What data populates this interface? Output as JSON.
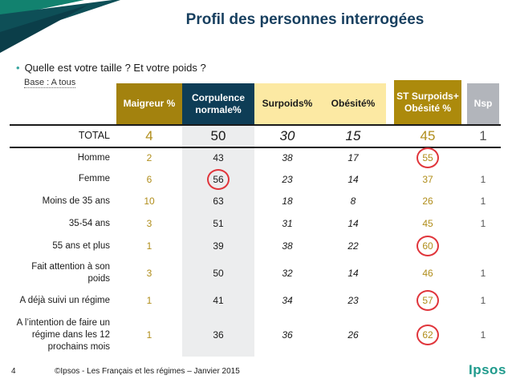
{
  "slide": {
    "title": "Profil des personnes interrogées",
    "question": "Quelle est votre taille ? Et votre poids ?",
    "base": "Base : A tous",
    "page_number": "4",
    "footer": "©Ipsos - Les Français et les régimes –  Janvier 2015",
    "logo": "Ipsos"
  },
  "colors": {
    "maigreur_header": "#a3820e",
    "corpulence_header": "#0e3d56",
    "surpoids_header": "#fce9a3",
    "st_header": "#ac8a0c",
    "nsp_header": "#b2b5bb",
    "highlight_circle": "#e0353b",
    "brand": "#1f9a8c",
    "title": "#173f5f"
  },
  "chart_data": {
    "type": "table",
    "columns": [
      "Maigreur %",
      "Corpulence normale%",
      "Surpoids%",
      "Obésité%",
      "ST Surpoids+ Obésité %",
      "Nsp"
    ],
    "rows": [
      {
        "label": "TOTAL",
        "values": [
          "4",
          "50",
          "30",
          "15",
          "45",
          "1"
        ]
      },
      {
        "label": "Homme",
        "values": [
          "2",
          "43",
          "38",
          "17",
          "55",
          ""
        ]
      },
      {
        "label": "Femme",
        "values": [
          "6",
          "56",
          "23",
          "14",
          "37",
          "1"
        ]
      },
      {
        "label": "Moins de 35 ans",
        "values": [
          "10",
          "63",
          "18",
          "8",
          "26",
          "1"
        ]
      },
      {
        "label": "35-54 ans",
        "values": [
          "3",
          "51",
          "31",
          "14",
          "45",
          "1"
        ]
      },
      {
        "label": "55 ans et plus",
        "values": [
          "1",
          "39",
          "38",
          "22",
          "60",
          ""
        ]
      },
      {
        "label": "Fait attention à son poids",
        "values": [
          "3",
          "50",
          "32",
          "14",
          "46",
          "1"
        ]
      },
      {
        "label": "A déjà suivi un régime",
        "values": [
          "1",
          "41",
          "34",
          "23",
          "57",
          "1"
        ]
      },
      {
        "label": "A l’intention de faire un régime dans les 12 prochains mois",
        "values": [
          "1",
          "36",
          "36",
          "26",
          "62",
          "1"
        ]
      }
    ],
    "highlighted": [
      {
        "row": "Homme",
        "column": "ST Surpoids+ Obésité %"
      },
      {
        "row": "Femme",
        "column": "Corpulence normale%"
      },
      {
        "row": "55 ans et plus",
        "column": "ST Surpoids+ Obésité %"
      },
      {
        "row": "A déjà suivi un régime",
        "column": "ST Surpoids+ Obésité %"
      },
      {
        "row": "A l’intention de faire un régime dans les 12 prochains mois",
        "column": "ST Surpoids+ Obésité %"
      }
    ]
  }
}
